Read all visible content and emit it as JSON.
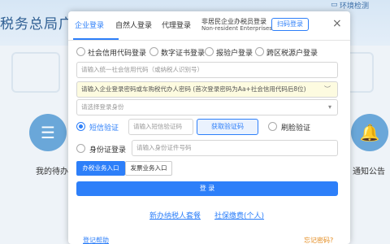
{
  "background": {
    "title": "税务总局广西",
    "top_link": "环境检测",
    "card_left_label": "我的待办",
    "card_right_label": "通知公告"
  },
  "dialog": {
    "tabs": [
      {
        "label": "企业登录",
        "active": true
      },
      {
        "label": "自然人登录",
        "active": false
      },
      {
        "label": "代理登录",
        "active": false
      }
    ],
    "nonresident_tab": {
      "line1": "非居民企业办税员登录",
      "line2": "Non-resident Enterprises Tx"
    },
    "scan_login_label": "扫码登录",
    "id_type_options": [
      {
        "label": "社会信用代码登录",
        "checked": true
      },
      {
        "label": "数字证书登录",
        "checked": false
      },
      {
        "label": "报验户登录",
        "checked": false
      },
      {
        "label": "跨区税源户登录",
        "checked": false
      }
    ],
    "credit_code_placeholder": "请输入统一社会信用代码（或纳税人识别号）",
    "password_placeholder": "请输入企业登录密码或车购税代办人密码 (首次登录密码为Aa+社会信用代码后8位)",
    "identity_select_placeholder": "请选择登录身份",
    "sms_verify_label": "短信验证",
    "sms_code_placeholder": "请输入短信验证码",
    "get_code_button": "获取验证码",
    "face_verify_label": "刷脸验证",
    "id_card_login_label": "身份证登录",
    "id_card_placeholder": "请输入身份证件号码",
    "entry_buttons": {
      "tax_business": "办税业务入口",
      "invoice_business": "发票业务入口"
    },
    "login_button": "登 录",
    "links": {
      "new_taxpayer_kit": "新办纳税人套餐",
      "social_insurance": "社保缴费(个人)",
      "register_help": "登记帮助",
      "forgot_password": "忘记密码?"
    }
  },
  "colors": {
    "accent": "#2d7ff9",
    "forgot_password": "#e38a1c"
  }
}
